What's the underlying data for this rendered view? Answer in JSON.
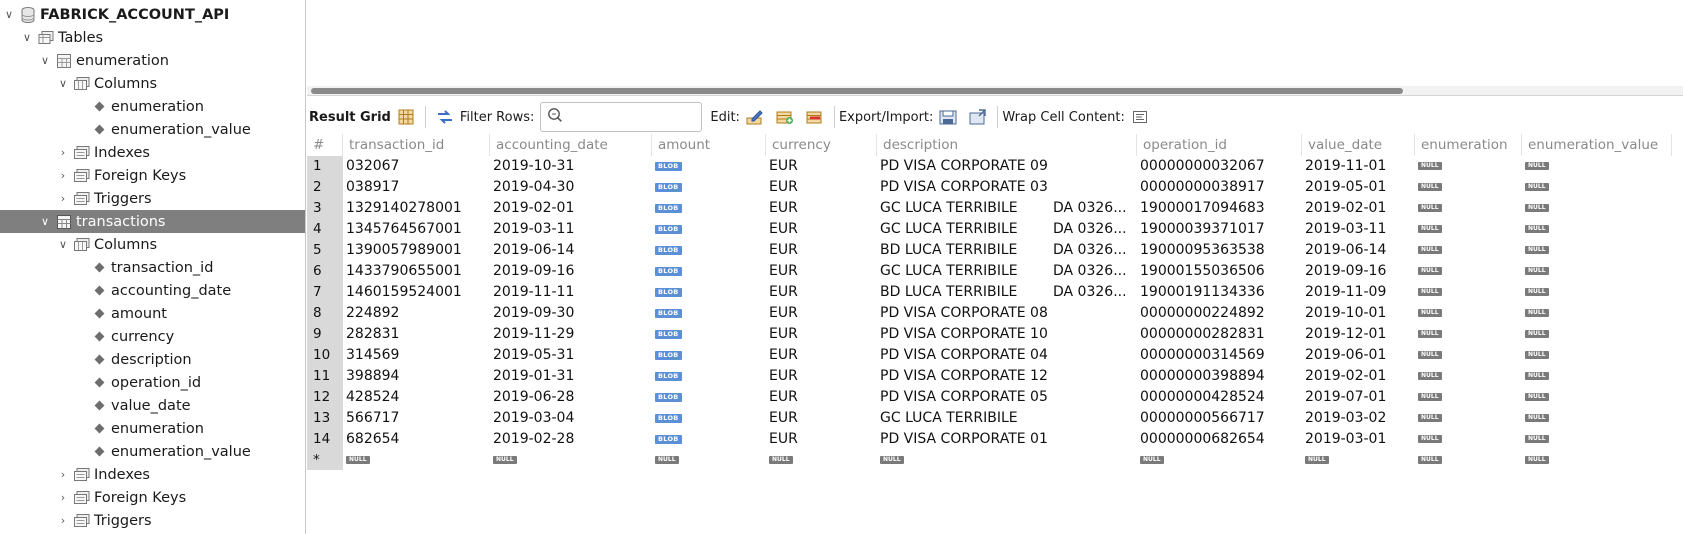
{
  "sidebar": {
    "schema": "FABRICK_ACCOUNT_API",
    "tables_label": "Tables",
    "t1": {
      "name": "enumeration",
      "columns_label": "Columns",
      "columns": [
        "enumeration",
        "enumeration_value"
      ],
      "indexes_label": "Indexes",
      "fk_label": "Foreign Keys",
      "triggers_label": "Triggers"
    },
    "t2": {
      "name": "transactions",
      "columns_label": "Columns",
      "columns": [
        "transaction_id",
        "accounting_date",
        "amount",
        "currency",
        "description",
        "operation_id",
        "value_date",
        "enumeration",
        "enumeration_value"
      ],
      "indexes_label": "Indexes",
      "fk_label": "Foreign Keys",
      "triggers_label": "Triggers"
    }
  },
  "toolbar": {
    "result_grid": "Result Grid",
    "filter_rows": "Filter Rows:",
    "filter_value": "",
    "edit": "Edit:",
    "export_import": "Export/Import:",
    "wrap": "Wrap Cell Content:"
  },
  "grid": {
    "headers": [
      "#",
      "transaction_id",
      "accounting_date",
      "amount",
      "currency",
      "description",
      "operation_id",
      "value_date",
      "enumeration",
      "enumeration_value"
    ],
    "blob": "BLOB",
    "null": "NULL",
    "new_row_marker": "*",
    "rows": [
      {
        "n": "1",
        "id": "032067",
        "acc": "2019-10-31",
        "cur": "EUR",
        "desc": "PD VISA CORPORATE 09",
        "desc2": "",
        "op": "00000000032067",
        "val": "2019-11-01"
      },
      {
        "n": "2",
        "id": "038917",
        "acc": "2019-04-30",
        "cur": "EUR",
        "desc": "PD VISA CORPORATE 03",
        "desc2": "",
        "op": "00000000038917",
        "val": "2019-05-01"
      },
      {
        "n": "3",
        "id": "1329140278001",
        "acc": "2019-02-01",
        "cur": "EUR",
        "desc": "GC LUCA TERRIBILE",
        "desc2": "DA 0326...",
        "op": "19000017094683",
        "val": "2019-02-01"
      },
      {
        "n": "4",
        "id": "1345764567001",
        "acc": "2019-03-11",
        "cur": "EUR",
        "desc": "GC LUCA TERRIBILE",
        "desc2": "DA 0326...",
        "op": "19000039371017",
        "val": "2019-03-11"
      },
      {
        "n": "5",
        "id": "1390057989001",
        "acc": "2019-06-14",
        "cur": "EUR",
        "desc": "BD LUCA TERRIBILE",
        "desc2": "DA 0326...",
        "op": "19000095363538",
        "val": "2019-06-14"
      },
      {
        "n": "6",
        "id": "1433790655001",
        "acc": "2019-09-16",
        "cur": "EUR",
        "desc": "GC LUCA TERRIBILE",
        "desc2": "DA 0326...",
        "op": "19000155036506",
        "val": "2019-09-16"
      },
      {
        "n": "7",
        "id": "1460159524001",
        "acc": "2019-11-11",
        "cur": "EUR",
        "desc": "BD LUCA TERRIBILE",
        "desc2": "DA 0326...",
        "op": "19000191134336",
        "val": "2019-11-09"
      },
      {
        "n": "8",
        "id": "224892",
        "acc": "2019-09-30",
        "cur": "EUR",
        "desc": "PD VISA CORPORATE 08",
        "desc2": "",
        "op": "00000000224892",
        "val": "2019-10-01"
      },
      {
        "n": "9",
        "id": "282831",
        "acc": "2019-11-29",
        "cur": "EUR",
        "desc": "PD VISA CORPORATE 10",
        "desc2": "",
        "op": "00000000282831",
        "val": "2019-12-01"
      },
      {
        "n": "10",
        "id": "314569",
        "acc": "2019-05-31",
        "cur": "EUR",
        "desc": "PD VISA CORPORATE 04",
        "desc2": "",
        "op": "00000000314569",
        "val": "2019-06-01"
      },
      {
        "n": "11",
        "id": "398894",
        "acc": "2019-01-31",
        "cur": "EUR",
        "desc": "PD VISA CORPORATE 12",
        "desc2": "",
        "op": "00000000398894",
        "val": "2019-02-01"
      },
      {
        "n": "12",
        "id": "428524",
        "acc": "2019-06-28",
        "cur": "EUR",
        "desc": "PD VISA CORPORATE 05",
        "desc2": "",
        "op": "00000000428524",
        "val": "2019-07-01"
      },
      {
        "n": "13",
        "id": "566717",
        "acc": "2019-03-04",
        "cur": "EUR",
        "desc": "GC LUCA TERRIBILE",
        "desc2": "",
        "op": "00000000566717",
        "val": "2019-03-02"
      },
      {
        "n": "14",
        "id": "682654",
        "acc": "2019-02-28",
        "cur": "EUR",
        "desc": "PD VISA CORPORATE 01",
        "desc2": "",
        "op": "00000000682654",
        "val": "2019-03-01"
      }
    ]
  }
}
